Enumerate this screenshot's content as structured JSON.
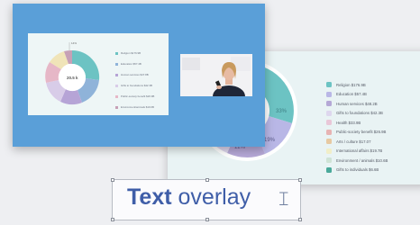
{
  "colors": {
    "canvas_bg": "#eeeff2",
    "front_slide_bg": "#5a9fd8",
    "card_bg": "#eef6f6",
    "back_slide_bg": "#e9f3f4",
    "overlay_text": "#3f5ea8"
  },
  "mini_chart": {
    "center_label": "20.5 k",
    "callout_label": "14%",
    "legend": [
      {
        "label": "Religion $176.9B",
        "color": "#6cc3c3"
      },
      {
        "label": "Education $57.4B",
        "color": "#8fb3d9"
      },
      {
        "label": "Human services $47.8B",
        "color": "#b6a4d6"
      },
      {
        "label": "Gifts to foundations $42.3B",
        "color": "#d8cce8"
      },
      {
        "label": "Public-society benefit $26.9B",
        "color": "#e6b7c7"
      },
      {
        "label": "Environment/animals $19.6B",
        "color": "#c6a0b6"
      }
    ]
  },
  "main_chart": {
    "labels": [
      "33%",
      "19%",
      "12%"
    ],
    "legend": [
      {
        "label": "Religion $176.9B",
        "color": "#6cc3c3"
      },
      {
        "label": "Education $57.4B",
        "color": "#b9b7e6"
      },
      {
        "label": "Human services $48.2B",
        "color": "#b5a8d6"
      },
      {
        "label": "Gifts to foundations $42.3B",
        "color": "#ded7ee"
      },
      {
        "label": "Health $33.9B",
        "color": "#e9c7d8"
      },
      {
        "label": "Public-society benefit $26.9B",
        "color": "#e7b3b3"
      },
      {
        "label": "Arts / culture $17.07",
        "color": "#e7c9a2"
      },
      {
        "label": "International affairs $19.7B",
        "color": "#f1eec8"
      },
      {
        "label": "Environment / animals $10.6B",
        "color": "#cfe3d6"
      },
      {
        "label": "Gifts to individuals $6.6B",
        "color": "#4aa99a"
      }
    ]
  },
  "text_overlay": {
    "bold_word": "Text",
    "rest": " overlay",
    "cursor_icon": "text-cursor-icon"
  }
}
